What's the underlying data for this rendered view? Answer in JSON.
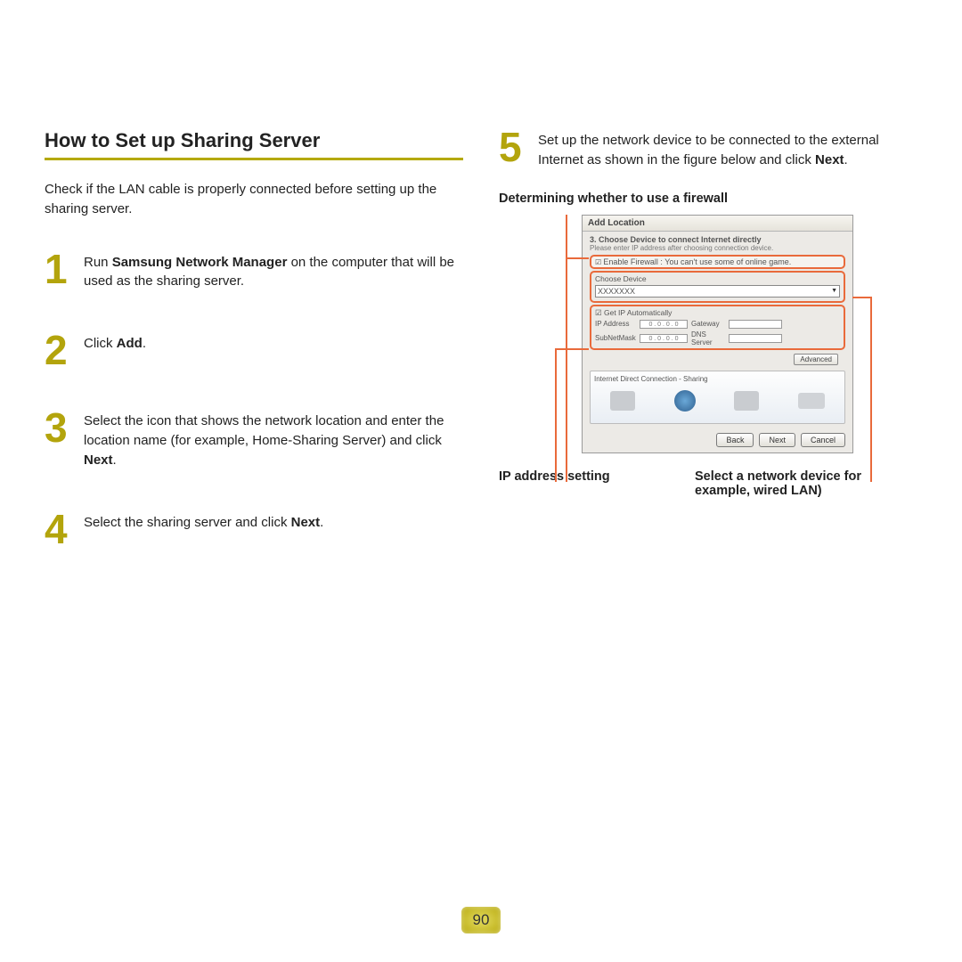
{
  "section_title": "How to Set up Sharing Server",
  "intro": "Check if the LAN cable is properly connected before setting up the sharing server.",
  "steps": {
    "s1": {
      "num": "1",
      "pre": "Run ",
      "bold": "Samsung Network Manager",
      "post": " on the computer that will be used as the sharing server."
    },
    "s2": {
      "num": "2",
      "pre": "Click ",
      "bold": "Add",
      "post": "."
    },
    "s3": {
      "num": "3",
      "pre": "Select the icon that shows the network location and enter the location name (for example, Home-Sharing Server) and click ",
      "bold": "Next",
      "post": "."
    },
    "s4": {
      "num": "4",
      "pre": "Select the sharing server and click ",
      "bold": "Next",
      "post": "."
    },
    "s5": {
      "num": "5",
      "pre": "Set up the network device to be connected to the external Internet as shown in the figure below and click ",
      "bold": "Next",
      "post": "."
    }
  },
  "callouts": {
    "top": "Determining whether to use a firewall",
    "bottom_left": "IP address setting",
    "bottom_right": "Select a network device for example, wired LAN)"
  },
  "dialog": {
    "title": "Add Location",
    "instr_bold": "3. Choose Device to connect Internet directly",
    "instr_small": "Please enter IP address after choosing connection device.",
    "firewall_text": "Enable Firewall : You can't use some of online game.",
    "choose_label": "Choose Device",
    "choose_value": "XXXXXXX",
    "get_ip": "Get IP Automatically",
    "ip_address": "IP Address",
    "subnet": "SubNetMask",
    "gateway": "Gateway",
    "dns": "DNS Server",
    "ip_placeholder": "0 . 0 . 0 . 0",
    "advanced": "Advanced",
    "panel_title": "Internet Direct Connection - Sharing",
    "btn_back": "Back",
    "btn_next": "Next",
    "btn_cancel": "Cancel"
  },
  "page_number": "90"
}
